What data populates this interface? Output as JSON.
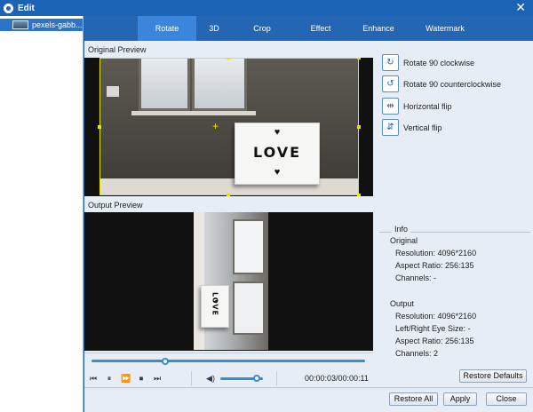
{
  "window": {
    "title": "Edit",
    "close_symbol": "✕"
  },
  "sidebar": {
    "files": [
      {
        "name": "pexels-gabb..."
      }
    ]
  },
  "tabs": [
    {
      "label": "Rotate",
      "active": true
    },
    {
      "label": "3D"
    },
    {
      "label": "Crop"
    },
    {
      "label": "Effect"
    },
    {
      "label": "Enhance"
    },
    {
      "label": "Watermark"
    }
  ],
  "preview": {
    "original_label": "Original Preview",
    "output_label": "Output Preview",
    "lightbox_text": "LOVE",
    "heart_glyph": "♥"
  },
  "player": {
    "timecode": "00:00:03/00:00:11",
    "seek_progress": 0.27,
    "volume_level": 0.85
  },
  "rotate_actions": [
    {
      "label": "Rotate 90 clockwise",
      "icon": "rotate-cw-icon",
      "glyph": "↻"
    },
    {
      "label": "Rotate 90 counterclockwise",
      "icon": "rotate-ccw-icon",
      "glyph": "↺"
    },
    {
      "label": "Horizontal flip",
      "icon": "horizontal-flip-icon",
      "glyph": "⇹"
    },
    {
      "label": "Vertical flip",
      "icon": "vertical-flip-icon",
      "glyph": "⇵"
    }
  ],
  "info": {
    "title": "Info",
    "original_heading": "Original",
    "original": {
      "resolution": "Resolution: 4096*2160",
      "aspect_ratio": "Aspect Ratio: 256:135",
      "channels": "Channels: -"
    },
    "output_heading": "Output",
    "output": {
      "resolution": "Resolution: 4096*2160",
      "eye_size": "Left/Right Eye Size: -",
      "aspect_ratio": "Aspect Ratio: 256:135",
      "channels": "Channels: 2"
    }
  },
  "buttons": {
    "restore_defaults": "Restore Defaults",
    "restore_all": "Restore All",
    "apply": "Apply",
    "close": "Close"
  },
  "colors": {
    "accent": "#2b74c8",
    "titlebar": "#1d63b4",
    "crop_frame": "#e8e600"
  }
}
